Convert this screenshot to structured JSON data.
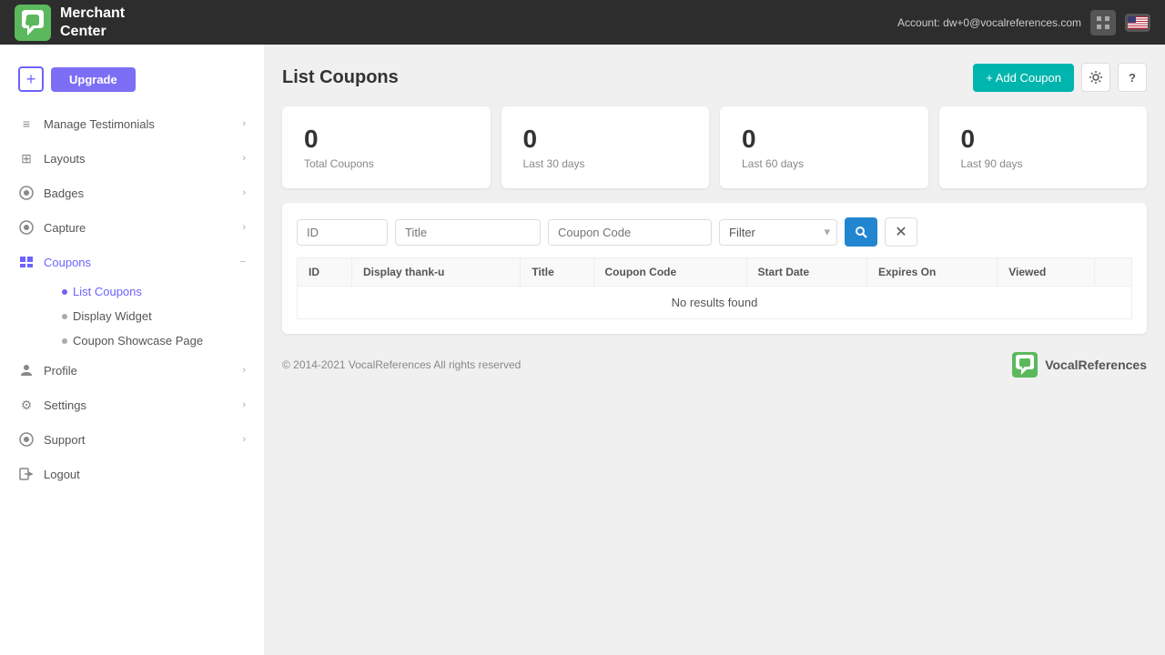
{
  "header": {
    "title_line1": "Merchant",
    "title_line2": "Center",
    "account_text": "Account: dw+0@vocalreferences.com"
  },
  "sidebar": {
    "upgrade_label": "Upgrade",
    "plus_label": "+",
    "items": [
      {
        "id": "manage-testimonials",
        "label": "Manage Testimonials",
        "icon": "≡",
        "has_chevron": true
      },
      {
        "id": "layouts",
        "label": "Layouts",
        "icon": "⊞",
        "has_chevron": true
      },
      {
        "id": "badges",
        "label": "Badges",
        "icon": "◎",
        "has_chevron": true
      },
      {
        "id": "capture",
        "label": "Capture",
        "icon": "◎",
        "has_chevron": true
      },
      {
        "id": "coupons",
        "label": "Coupons",
        "icon": "▣",
        "has_chevron": true,
        "active": true,
        "sub_items": [
          {
            "id": "list-coupons",
            "label": "List Coupons",
            "active": true
          },
          {
            "id": "display-widget",
            "label": "Display Widget",
            "active": false
          },
          {
            "id": "coupon-showcase-page",
            "label": "Coupon Showcase Page",
            "active": false
          }
        ]
      },
      {
        "id": "profile",
        "label": "Profile",
        "icon": "👤",
        "has_chevron": true
      },
      {
        "id": "settings",
        "label": "Settings",
        "icon": "⚙",
        "has_chevron": true
      },
      {
        "id": "support",
        "label": "Support",
        "icon": "◎",
        "has_chevron": true
      },
      {
        "id": "logout",
        "label": "Logout",
        "icon": "⬚",
        "has_chevron": false
      }
    ]
  },
  "main": {
    "page_title": "List Coupons",
    "add_button_label": "+ Add Coupon",
    "stats": [
      {
        "value": "0",
        "label": "Total Coupons"
      },
      {
        "value": "0",
        "label": "Last 30 days"
      },
      {
        "value": "0",
        "label": "Last 60 days"
      },
      {
        "value": "0",
        "label": "Last 90 days"
      }
    ],
    "filters": {
      "id_placeholder": "ID",
      "title_placeholder": "Title",
      "coupon_code_placeholder": "Coupon Code",
      "filter_label": "Filter"
    },
    "table": {
      "columns": [
        "ID",
        "Display thank-u",
        "Title",
        "Coupon Code",
        "Start Date",
        "Expires On",
        "Viewed",
        ""
      ],
      "no_results": "No results found"
    }
  },
  "footer": {
    "copyright": "© 2014-2021 VocalReferences All rights reserved",
    "logo_text": "VocalReferences"
  }
}
